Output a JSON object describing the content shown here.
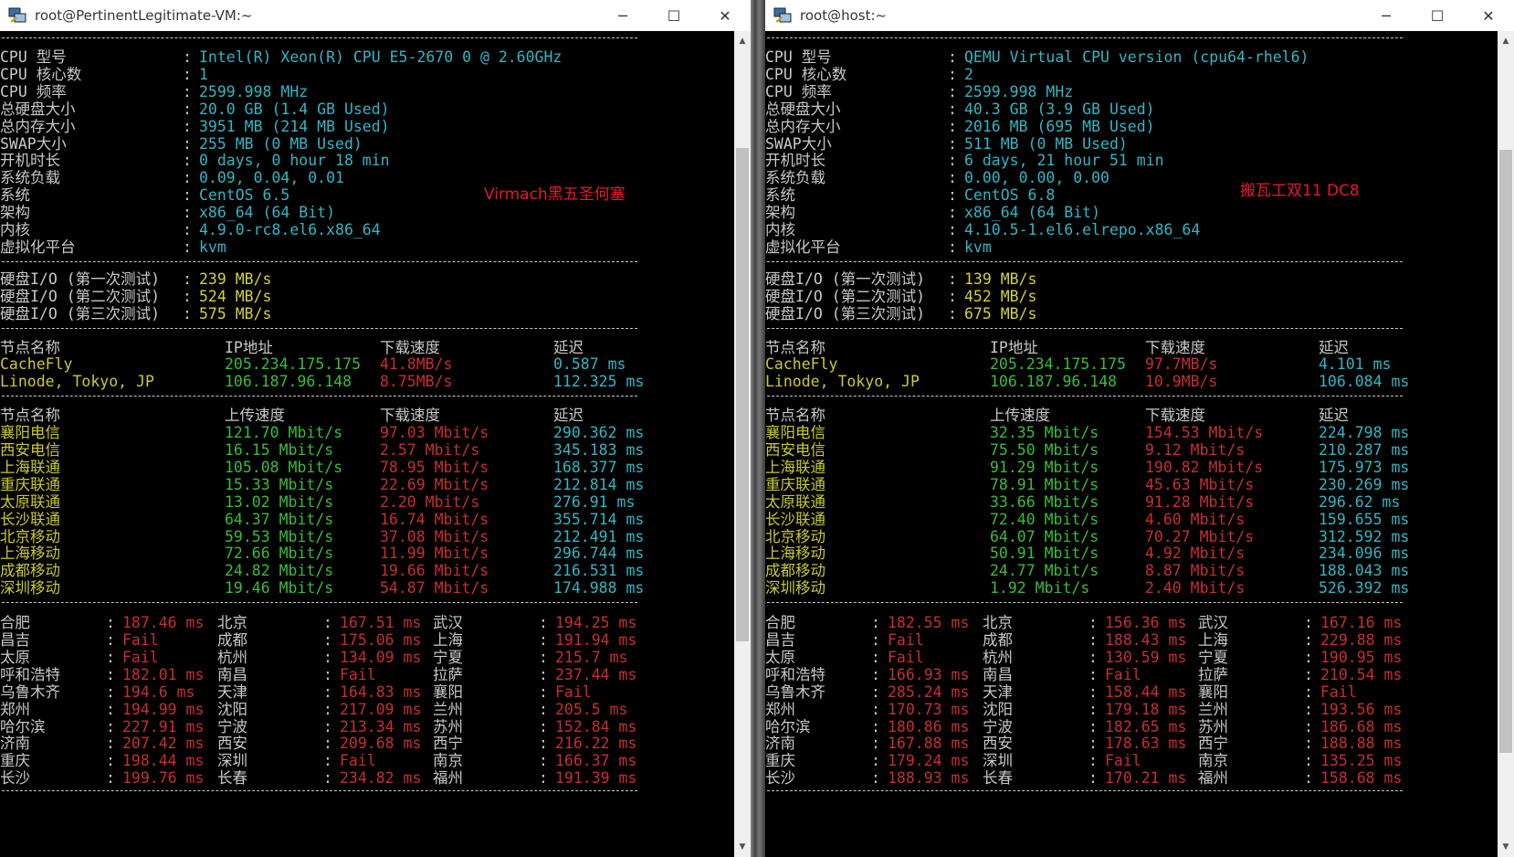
{
  "left": {
    "title": "root@PertinentLegitimate-VM:~",
    "annotation": "Virmach黑五圣何塞",
    "sysinfo": [
      {
        "k": "CPU 型号",
        "v": "Intel(R) Xeon(R) CPU E5-2670 0 @ 2.60GHz"
      },
      {
        "k": "CPU 核心数",
        "v": "1"
      },
      {
        "k": "CPU 频率",
        "v": "2599.998 MHz"
      },
      {
        "k": "总硬盘大小",
        "v": "20.0 GB (1.4 GB Used)"
      },
      {
        "k": "总内存大小",
        "v": "3951 MB (214 MB Used)"
      },
      {
        "k": "SWAP大小",
        "v": "255 MB (0 MB Used)"
      },
      {
        "k": "开机时长",
        "v": "0 days, 0 hour 18 min"
      },
      {
        "k": "系统负载",
        "v": "0.09, 0.04, 0.01"
      },
      {
        "k": "系统",
        "v": "CentOS 6.5"
      },
      {
        "k": "架构",
        "v": "x86_64 (64 Bit)"
      },
      {
        "k": "内核",
        "v": "4.9.0-rc8.el6.x86_64"
      },
      {
        "k": "虚拟化平台",
        "v": "kvm"
      }
    ],
    "io": [
      {
        "k": "硬盘I/O (第一次测试)",
        "v": "239 MB/s"
      },
      {
        "k": "硬盘I/O (第二次测试)",
        "v": "524 MB/s"
      },
      {
        "k": "硬盘I/O (第三次测试)",
        "v": "575 MB/s"
      }
    ],
    "dl_header": [
      "节点名称",
      "IP地址",
      "下载速度",
      "延迟"
    ],
    "dl_rows": [
      [
        "CacheFly",
        "205.234.175.175",
        "41.8MB/s",
        "0.587 ms"
      ],
      [
        "Linode, Tokyo, JP",
        "106.187.96.148",
        "8.75MB/s",
        "112.325 ms"
      ]
    ],
    "sp_header": [
      "节点名称",
      "上传速度",
      "下载速度",
      "延迟"
    ],
    "sp_rows": [
      [
        "襄阳电信",
        "121.70 Mbit/s",
        "97.03 Mbit/s",
        "290.362 ms"
      ],
      [
        "西安电信",
        "16.15 Mbit/s",
        "2.57 Mbit/s",
        "345.183 ms"
      ],
      [
        "上海联通",
        "105.08 Mbit/s",
        "78.95 Mbit/s",
        "168.377 ms"
      ],
      [
        "重庆联通",
        "15.33 Mbit/s",
        "22.69 Mbit/s",
        "212.814 ms"
      ],
      [
        "太原联通",
        "13.02 Mbit/s",
        "2.20 Mbit/s",
        "276.91 ms"
      ],
      [
        "长沙联通",
        "64.37 Mbit/s",
        "16.74 Mbit/s",
        "355.714 ms"
      ],
      [
        "北京移动",
        "59.53 Mbit/s",
        "37.08 Mbit/s",
        "212.491 ms"
      ],
      [
        "上海移动",
        "72.66 Mbit/s",
        "11.99 Mbit/s",
        "296.744 ms"
      ],
      [
        "成都移动",
        "24.82 Mbit/s",
        "19.66 Mbit/s",
        "216.531 ms"
      ],
      [
        "深圳移动",
        "19.46 Mbit/s",
        "54.87 Mbit/s",
        "174.988 ms"
      ]
    ],
    "ping_rows": [
      [
        "合肥",
        "187.46 ms",
        "北京",
        "167.51 ms",
        "武汉",
        "194.25 ms"
      ],
      [
        "昌吉",
        "Fail",
        "成都",
        "175.06 ms",
        "上海",
        "191.94 ms"
      ],
      [
        "太原",
        "Fail",
        "杭州",
        "134.09 ms",
        "宁夏",
        "215.7 ms"
      ],
      [
        "呼和浩特",
        "182.01 ms",
        "南昌",
        "Fail",
        "拉萨",
        "237.44 ms"
      ],
      [
        "乌鲁木齐",
        "194.6 ms",
        "天津",
        "164.83 ms",
        "襄阳",
        "Fail"
      ],
      [
        "郑州",
        "194.99 ms",
        "沈阳",
        "217.09 ms",
        "兰州",
        "205.5 ms"
      ],
      [
        "哈尔滨",
        "227.91 ms",
        "宁波",
        "213.34 ms",
        "苏州",
        "152.84 ms"
      ],
      [
        "济南",
        "207.42 ms",
        "西安",
        "209.68 ms",
        "西宁",
        "216.22 ms"
      ],
      [
        "重庆",
        "198.44 ms",
        "深圳",
        "Fail",
        "南京",
        "166.37 ms"
      ],
      [
        "长沙",
        "199.76 ms",
        "长春",
        "234.82 ms",
        "福州",
        "191.39 ms"
      ]
    ]
  },
  "right": {
    "title": "root@host:~",
    "annotation": "搬瓦工双11 DC8",
    "sysinfo": [
      {
        "k": "CPU 型号",
        "v": "QEMU Virtual CPU version (cpu64-rhel6)"
      },
      {
        "k": "CPU 核心数",
        "v": "2"
      },
      {
        "k": "CPU 频率",
        "v": "2599.998 MHz"
      },
      {
        "k": "总硬盘大小",
        "v": "40.3 GB (3.9 GB Used)"
      },
      {
        "k": "总内存大小",
        "v": "2016 MB (695 MB Used)"
      },
      {
        "k": "SWAP大小",
        "v": "511 MB (0 MB Used)"
      },
      {
        "k": "开机时长",
        "v": "6 days, 21 hour 51 min"
      },
      {
        "k": "系统负载",
        "v": "0.00, 0.00, 0.00"
      },
      {
        "k": "系统",
        "v": "CentOS 6.8"
      },
      {
        "k": "架构",
        "v": "x86_64 (64 Bit)"
      },
      {
        "k": "内核",
        "v": "4.10.5-1.el6.elrepo.x86_64"
      },
      {
        "k": "虚拟化平台",
        "v": "kvm"
      }
    ],
    "io": [
      {
        "k": "硬盘I/O (第一次测试)",
        "v": "139 MB/s"
      },
      {
        "k": "硬盘I/O (第二次测试)",
        "v": "452 MB/s"
      },
      {
        "k": "硬盘I/O (第三次测试)",
        "v": "675 MB/s"
      }
    ],
    "dl_header": [
      "节点名称",
      "IP地址",
      "下载速度",
      "延迟"
    ],
    "dl_rows": [
      [
        "CacheFly",
        "205.234.175.175",
        "97.7MB/s",
        "4.101 ms"
      ],
      [
        "Linode, Tokyo, JP",
        "106.187.96.148",
        "10.9MB/s",
        "106.084 ms"
      ]
    ],
    "sp_header": [
      "节点名称",
      "上传速度",
      "下载速度",
      "延迟"
    ],
    "sp_rows": [
      [
        "襄阳电信",
        "32.35 Mbit/s",
        "154.53 Mbit/s",
        "224.798 ms"
      ],
      [
        "西安电信",
        "75.50 Mbit/s",
        "9.12 Mbit/s",
        "210.287 ms"
      ],
      [
        "上海联通",
        "91.29 Mbit/s",
        "190.82 Mbit/s",
        "175.973 ms"
      ],
      [
        "重庆联通",
        "78.91 Mbit/s",
        "45.63 Mbit/s",
        "230.269 ms"
      ],
      [
        "太原联通",
        "33.66 Mbit/s",
        "91.28 Mbit/s",
        "296.62 ms"
      ],
      [
        "长沙联通",
        "72.40 Mbit/s",
        "4.60 Mbit/s",
        "159.655 ms"
      ],
      [
        "北京移动",
        "64.07 Mbit/s",
        "70.27 Mbit/s",
        "312.592 ms"
      ],
      [
        "上海移动",
        "50.91 Mbit/s",
        "4.92 Mbit/s",
        "234.096 ms"
      ],
      [
        "成都移动",
        "24.77 Mbit/s",
        "8.87 Mbit/s",
        "188.043 ms"
      ],
      [
        "深圳移动",
        "1.92 Mbit/s",
        "2.40 Mbit/s",
        "526.392 ms"
      ]
    ],
    "ping_rows": [
      [
        "合肥",
        "182.55 ms",
        "北京",
        "156.36 ms",
        "武汉",
        "167.16 ms"
      ],
      [
        "昌吉",
        "Fail",
        "成都",
        "188.43 ms",
        "上海",
        "229.88 ms"
      ],
      [
        "太原",
        "Fail",
        "杭州",
        "130.59 ms",
        "宁夏",
        "190.95 ms"
      ],
      [
        "呼和浩特",
        "166.93 ms",
        "南昌",
        "Fail",
        "拉萨",
        "210.54 ms"
      ],
      [
        "乌鲁木齐",
        "285.24 ms",
        "天津",
        "158.44 ms",
        "襄阳",
        "Fail"
      ],
      [
        "郑州",
        "170.73 ms",
        "沈阳",
        "179.18 ms",
        "兰州",
        "193.56 ms"
      ],
      [
        "哈尔滨",
        "180.86 ms",
        "宁波",
        "182.65 ms",
        "苏州",
        "186.68 ms"
      ],
      [
        "济南",
        "167.88 ms",
        "西安",
        "178.63 ms",
        "西宁",
        "188.88 ms"
      ],
      [
        "重庆",
        "179.24 ms",
        "深圳",
        "Fail",
        "南京",
        "135.25 ms"
      ],
      [
        "长沙",
        "188.93 ms",
        "长春",
        "170.21 ms",
        "福州",
        "158.68 ms"
      ]
    ]
  },
  "controls": {
    "minimize": "─",
    "maximize": "☐",
    "close": "✕",
    "scroll_up": "▲",
    "scroll_down": "▼"
  },
  "colors": {
    "cyan": "#34b5c4",
    "yellow": "#c9c935",
    "green": "#3cbb3c",
    "red": "#c53030",
    "white": "#c8c8c8",
    "annotation": "#e8192c"
  }
}
